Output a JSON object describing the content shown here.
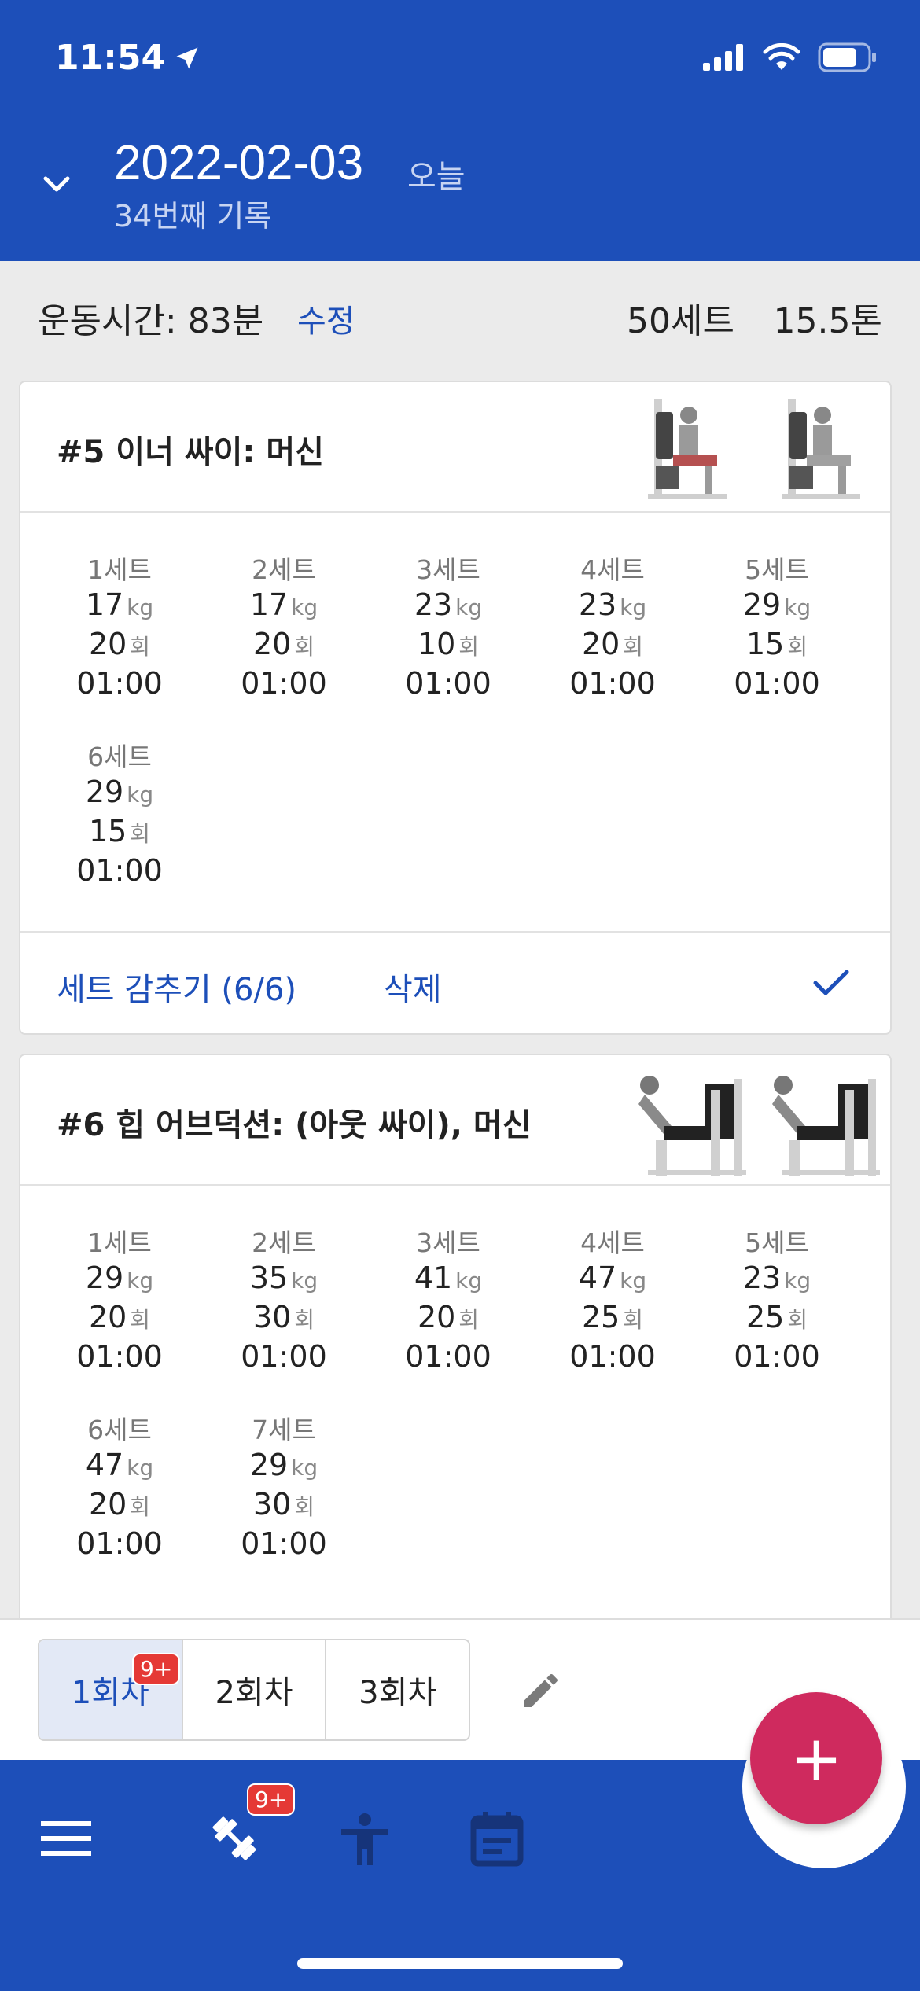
{
  "status_bar": {
    "time": "11:54"
  },
  "header": {
    "date": "2022-02-03",
    "today_label": "오늘",
    "record_count": "34번째 기록"
  },
  "summary": {
    "duration": "운동시간: 83분",
    "edit_label": "수정",
    "total_sets": "50세트",
    "total_weight": "15.5톤"
  },
  "exercises": [
    {
      "title": "#5 이너 싸이: 머신",
      "sets": [
        {
          "label": "1세트",
          "weight": "17",
          "reps": "20",
          "rest": "01:00"
        },
        {
          "label": "2세트",
          "weight": "17",
          "reps": "20",
          "rest": "01:00"
        },
        {
          "label": "3세트",
          "weight": "23",
          "reps": "10",
          "rest": "01:00"
        },
        {
          "label": "4세트",
          "weight": "23",
          "reps": "20",
          "rest": "01:00"
        },
        {
          "label": "5세트",
          "weight": "29",
          "reps": "15",
          "rest": "01:00"
        },
        {
          "label": "6세트",
          "weight": "29",
          "reps": "15",
          "rest": "01:00"
        }
      ],
      "hide_sets_label": "세트 감추기 (6/6)",
      "delete_label": "삭제"
    },
    {
      "title": "#6 힙 어브덕션: (아웃 싸이), 머신",
      "sets": [
        {
          "label": "1세트",
          "weight": "29",
          "reps": "20",
          "rest": "01:00"
        },
        {
          "label": "2세트",
          "weight": "35",
          "reps": "30",
          "rest": "01:00"
        },
        {
          "label": "3세트",
          "weight": "41",
          "reps": "20",
          "rest": "01:00"
        },
        {
          "label": "4세트",
          "weight": "47",
          "reps": "25",
          "rest": "01:00"
        },
        {
          "label": "5세트",
          "weight": "23",
          "reps": "25",
          "rest": "01:00"
        },
        {
          "label": "6세트",
          "weight": "47",
          "reps": "20",
          "rest": "01:00"
        },
        {
          "label": "7세트",
          "weight": "29",
          "reps": "30",
          "rest": "01:00"
        }
      ]
    }
  ],
  "units": {
    "weight": "kg",
    "reps": "회"
  },
  "session_tabs": [
    {
      "label": "1회차",
      "badge": "9+"
    },
    {
      "label": "2회차"
    },
    {
      "label": "3회차"
    }
  ],
  "bottom_nav": {
    "workout_badge": "9+",
    "fab_label": "+"
  },
  "colors": {
    "primary": "#1d4fb9",
    "fab": "#cf2a5e",
    "badge": "#e53935"
  },
  "icons": [
    "location-arrow-icon",
    "signal-icon",
    "wifi-icon",
    "battery-icon",
    "chevron-down-icon",
    "check-icon",
    "pencil-icon",
    "menu-icon",
    "dumbbell-icon",
    "person-icon",
    "calendar-icon"
  ]
}
